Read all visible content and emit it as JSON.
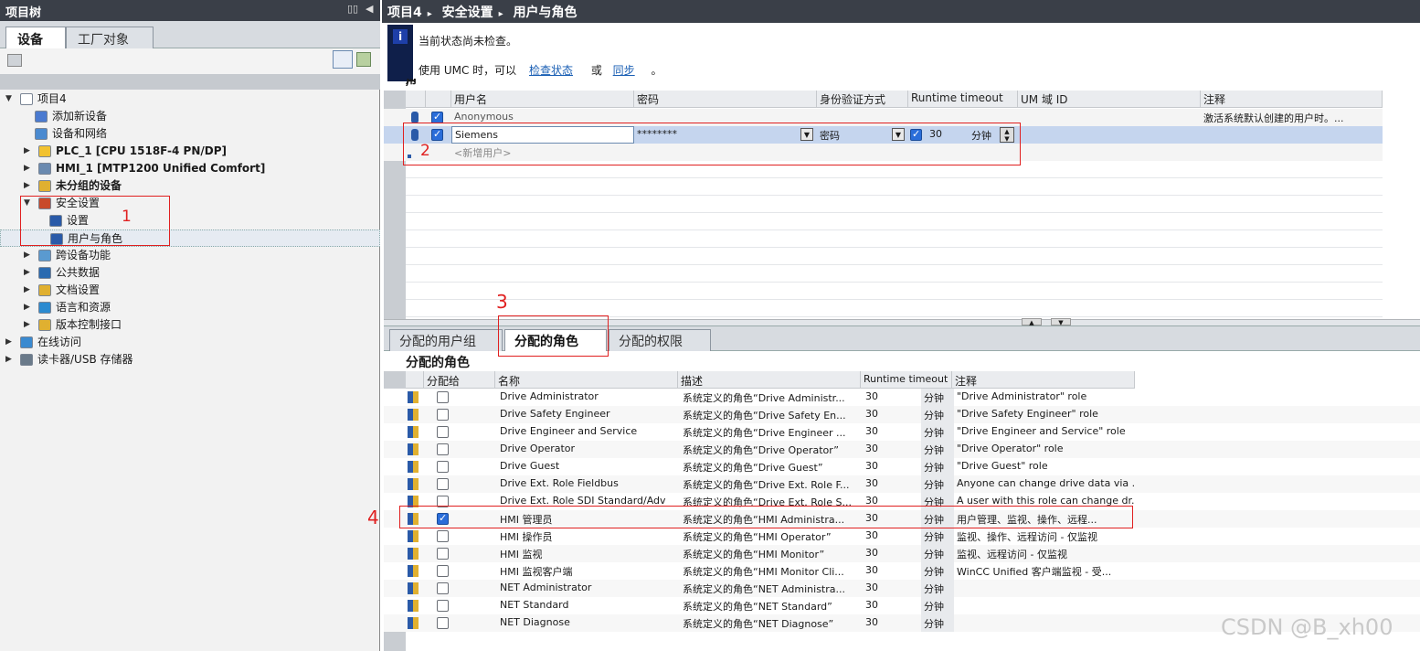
{
  "left": {
    "title": "项目树",
    "tabs": [
      "设备",
      "工厂对象"
    ],
    "tree": [
      {
        "label": "项目4",
        "level": 0,
        "arrow": "▼",
        "icon_color": "#ffffff",
        "bold": false,
        "selected": false
      },
      {
        "label": "添加新设备",
        "level": 2,
        "arrow": "",
        "icon_color": "#4a7ad0",
        "bold": false,
        "selected": false
      },
      {
        "label": "设备和网络",
        "level": 2,
        "arrow": "",
        "icon_color": "#4a8ad0",
        "bold": false,
        "selected": false
      },
      {
        "label": "PLC_1 [CPU 1518F-4 PN/DP]",
        "level": 1,
        "arrow": "▶",
        "icon_color": "#f2c230",
        "bold": true,
        "selected": false
      },
      {
        "label": "HMI_1 [MTP1200 Unified Comfort]",
        "level": 1,
        "arrow": "▶",
        "icon_color": "#6a8ab0",
        "bold": true,
        "selected": false
      },
      {
        "label": "未分组的设备",
        "level": 1,
        "arrow": "▶",
        "icon_color": "#e0b030",
        "bold": true,
        "selected": false
      },
      {
        "label": "安全设置",
        "level": 1,
        "arrow": "▼",
        "icon_color": "#c84a2a",
        "bold": false,
        "selected": false
      },
      {
        "label": "设置",
        "level": 3,
        "arrow": "",
        "icon_color": "#2a5aa8",
        "bold": false,
        "selected": false
      },
      {
        "label": "用户与角色",
        "level": 3,
        "arrow": "",
        "icon_color": "#2a5aa8",
        "bold": false,
        "selected": true
      },
      {
        "label": "跨设备功能",
        "level": 1,
        "arrow": "▶",
        "icon_color": "#5a9ad0",
        "bold": false,
        "selected": false
      },
      {
        "label": "公共数据",
        "level": 1,
        "arrow": "▶",
        "icon_color": "#2a6ab0",
        "bold": false,
        "selected": false
      },
      {
        "label": "文档设置",
        "level": 1,
        "arrow": "▶",
        "icon_color": "#e0b030",
        "bold": false,
        "selected": false
      },
      {
        "label": "语言和资源",
        "level": 1,
        "arrow": "▶",
        "icon_color": "#2a8ad0",
        "bold": false,
        "selected": false
      },
      {
        "label": "版本控制接口",
        "level": 1,
        "arrow": "▶",
        "icon_color": "#e0b030",
        "bold": false,
        "selected": false
      },
      {
        "label": "在线访问",
        "level": 0,
        "arrow": "▶",
        "icon_color": "#3a8ad0",
        "bold": false,
        "selected": false
      },
      {
        "label": "读卡器/USB 存储器",
        "level": 0,
        "arrow": "▶",
        "icon_color": "#6a7a8a",
        "bold": false,
        "selected": false
      }
    ]
  },
  "crumb": [
    "项目4",
    "安全设置",
    "用户与角色"
  ],
  "info": {
    "line1": "当前状态尚未检查。",
    "line2_prefix": "使用 UMC 时，可以",
    "link1": "检查状态",
    "mid": "或",
    "link2": "同步",
    "end": "。"
  },
  "users": {
    "headers": [
      "用户名",
      "密码",
      "身份验证方式",
      "Runtime timeout",
      "UM 域 ID",
      "注释"
    ],
    "rows": [
      {
        "name": "Anonymous",
        "password": "",
        "auth": "",
        "rt_checked": false,
        "timeout": "",
        "unit": "",
        "umid": "",
        "comment": "激活系统默认创建的用户时。..."
      },
      {
        "name": "Siemens",
        "password": "********",
        "auth": "密码",
        "rt_checked": true,
        "timeout": "30",
        "unit": "分钟",
        "umid": "",
        "comment": ""
      }
    ],
    "add_placeholder": "<新增用户>"
  },
  "tabs2": [
    "分配的用户组",
    "分配的角色",
    "分配的权限"
  ],
  "roles_title": "分配的角色",
  "roles": {
    "headers": [
      "分配给",
      "名称",
      "描述",
      "Runtime timeout",
      "注释"
    ],
    "rows": [
      {
        "assigned": false,
        "name": "Drive Administrator",
        "desc": "系统定义的角色“Drive Administr...",
        "timeout": "30",
        "unit": "分钟",
        "comment": "\"Drive Administrator\" role"
      },
      {
        "assigned": false,
        "name": "Drive Safety Engineer",
        "desc": "系统定义的角色“Drive Safety En...",
        "timeout": "30",
        "unit": "分钟",
        "comment": "\"Drive Safety Engineer\" role"
      },
      {
        "assigned": false,
        "name": "Drive Engineer and Service",
        "desc": "系统定义的角色“Drive Engineer ...",
        "timeout": "30",
        "unit": "分钟",
        "comment": "\"Drive Engineer and Service\" role"
      },
      {
        "assigned": false,
        "name": "Drive Operator",
        "desc": "系统定义的角色“Drive Operator”",
        "timeout": "30",
        "unit": "分钟",
        "comment": "\"Drive Operator\" role"
      },
      {
        "assigned": false,
        "name": "Drive Guest",
        "desc": "系统定义的角色“Drive Guest”",
        "timeout": "30",
        "unit": "分钟",
        "comment": "\"Drive Guest\" role"
      },
      {
        "assigned": false,
        "name": "Drive Ext. Role Fieldbus",
        "desc": "系统定义的角色“Drive Ext. Role F...",
        "timeout": "30",
        "unit": "分钟",
        "comment": "Anyone can change drive data via ..."
      },
      {
        "assigned": false,
        "name": "Drive Ext. Role SDI Standard/Adv",
        "desc": "系统定义的角色“Drive Ext. Role S...",
        "timeout": "30",
        "unit": "分钟",
        "comment": "A user with this role can change dr..."
      },
      {
        "assigned": true,
        "name": "HMI 管理员",
        "desc": "系统定义的角色“HMI Administra...",
        "timeout": "30",
        "unit": "分钟",
        "comment": "用户管理、监视、操作、远程..."
      },
      {
        "assigned": false,
        "name": "HMI 操作员",
        "desc": "系统定义的角色“HMI Operator”",
        "timeout": "30",
        "unit": "分钟",
        "comment": "监视、操作、远程访问 - 仅监视"
      },
      {
        "assigned": false,
        "name": "HMI 监视",
        "desc": "系统定义的角色“HMI Monitor”",
        "timeout": "30",
        "unit": "分钟",
        "comment": "监视、远程访问 - 仅监视"
      },
      {
        "assigned": false,
        "name": "HMI 监视客户端",
        "desc": "系统定义的角色“HMI Monitor Cli...",
        "timeout": "30",
        "unit": "分钟",
        "comment": "WinCC Unified 客户端监视 - 受..."
      },
      {
        "assigned": false,
        "name": "NET Administrator",
        "desc": "系统定义的角色“NET Administra...",
        "timeout": "30",
        "unit": "分钟",
        "comment": ""
      },
      {
        "assigned": false,
        "name": "NET Standard",
        "desc": "系统定义的角色“NET Standard”",
        "timeout": "30",
        "unit": "分钟",
        "comment": ""
      },
      {
        "assigned": false,
        "name": "NET Diagnose",
        "desc": "系统定义的角色“NET Diagnose”",
        "timeout": "30",
        "unit": "分钟",
        "comment": ""
      }
    ]
  },
  "annotations": [
    "1",
    "2",
    "3",
    "4"
  ],
  "watermark": "CSDN @B_xh00",
  "colors": {
    "annotation": "#e02020",
    "selected_row": "#c5d5ee",
    "title_bar": "#3a3f48"
  }
}
